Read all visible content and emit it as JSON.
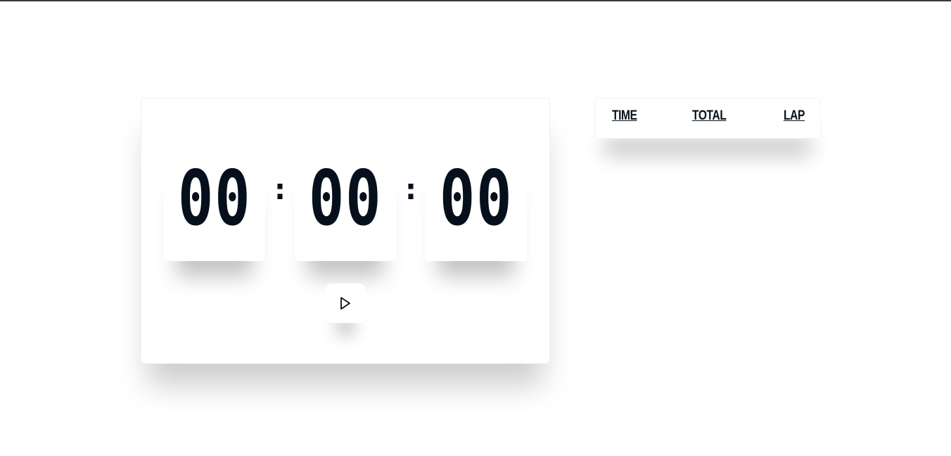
{
  "stopwatch": {
    "hours": "00",
    "minutes": "00",
    "seconds": "00",
    "separator": ":",
    "play_icon": "play-icon"
  },
  "laps": {
    "columns": [
      "TIME",
      "TOTAL",
      "LAP"
    ]
  },
  "colors": {
    "text": "#06101c",
    "background": "#ffffff",
    "top_border": "#3a3a3a"
  }
}
